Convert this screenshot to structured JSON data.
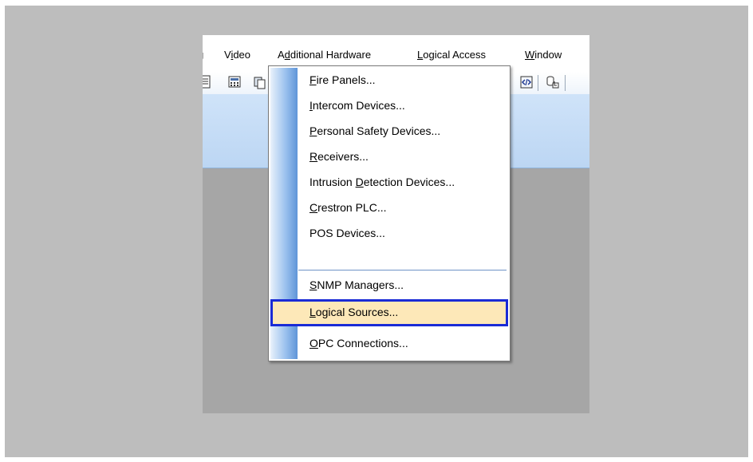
{
  "menubar": {
    "items": [
      {
        "label": "g",
        "mnemonic": null
      },
      {
        "label": "Video",
        "mnemonic": "i"
      },
      {
        "label": "Additional Hardware",
        "mnemonic": "d"
      },
      {
        "label": "Logical Access",
        "mnemonic": "L"
      },
      {
        "label": "Window",
        "mnemonic": "W"
      }
    ]
  },
  "toolbar": {
    "icons": [
      "document-icon",
      "calculator-icon",
      "copy-icon",
      "html-code-icon",
      "database-export-icon"
    ]
  },
  "dropdown": {
    "items": [
      {
        "label": "Fire Panels...",
        "mnemonic": "F",
        "selected": false
      },
      {
        "label": "Intercom Devices...",
        "mnemonic": "I",
        "selected": false
      },
      {
        "label": "Personal Safety Devices...",
        "mnemonic": "P",
        "selected": false
      },
      {
        "label": "Receivers...",
        "mnemonic": "R",
        "selected": false
      },
      {
        "label": "Intrusion Detection Devices...",
        "mnemonic": "D",
        "selected": false
      },
      {
        "label": "Crestron PLC...",
        "mnemonic": "C",
        "selected": false
      },
      {
        "label": "POS Devices...",
        "mnemonic": null,
        "selected": false
      },
      {
        "label": "SNMP Managers...",
        "mnemonic": "S",
        "selected": false
      },
      {
        "label": "Logical Sources...",
        "mnemonic": "L",
        "selected": true
      },
      {
        "label": "OPC Connections...",
        "mnemonic": "O",
        "selected": false
      }
    ]
  },
  "colors": {
    "selection_fill": "#fde8b8",
    "selection_border": "#1a2bd6",
    "ribbon": "#bcd6f3",
    "workspace": "#a6a6a6",
    "background": "#bdbdbd"
  }
}
